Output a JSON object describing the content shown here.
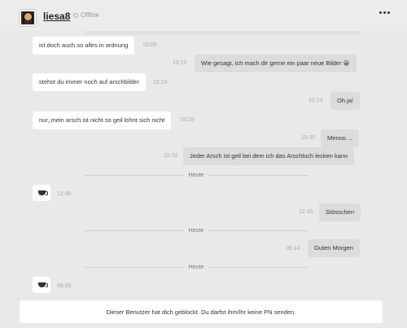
{
  "header": {
    "username": "liesa8",
    "status": "Offline",
    "avatar_icon": "user-avatar-icon",
    "menu_icon": "more-options-icon"
  },
  "messages": [
    {
      "direction": "in",
      "text": "ist doch auch so alles in ordnung",
      "time": "10:05"
    },
    {
      "direction": "out",
      "text": "Wie gesagt, ich mach dir gerne ein paar neue Bilder 😀",
      "time": "10:10"
    },
    {
      "direction": "in",
      "text": "stehst du immer noch auf arschbilder",
      "time": "15:24"
    },
    {
      "direction": "out",
      "text": "Oh ja!",
      "time": "15:24"
    },
    {
      "direction": "in",
      "text": "nur,,mein arsch ist nicht so geil lohnt sich nicht",
      "time": "15:28"
    },
    {
      "direction": "out",
      "text": "Menno ...",
      "time": "15:30"
    },
    {
      "direction": "out",
      "text": "Jeder Arsch ist geil bei dem ich das Arschloch lecken kann",
      "time": "15:32"
    },
    {
      "direction": "divider",
      "text": "Heute"
    },
    {
      "direction": "in-emoji",
      "icon": "coffee-cup-icon",
      "time": "12:40"
    },
    {
      "direction": "out",
      "text": "Stösschen",
      "time": "12:45"
    },
    {
      "direction": "divider",
      "text": "Heute"
    },
    {
      "direction": "out",
      "text": "Guten Morgen",
      "time": "06:14"
    },
    {
      "direction": "divider",
      "text": "Heute"
    },
    {
      "direction": "in-emoji",
      "icon": "coffee-cup-icon",
      "time": "08:09"
    }
  ],
  "footer": {
    "blocked_text": "Dieser Benutzer hat dich geblockt. Du darfst ihm/ihr keine PN senden."
  }
}
